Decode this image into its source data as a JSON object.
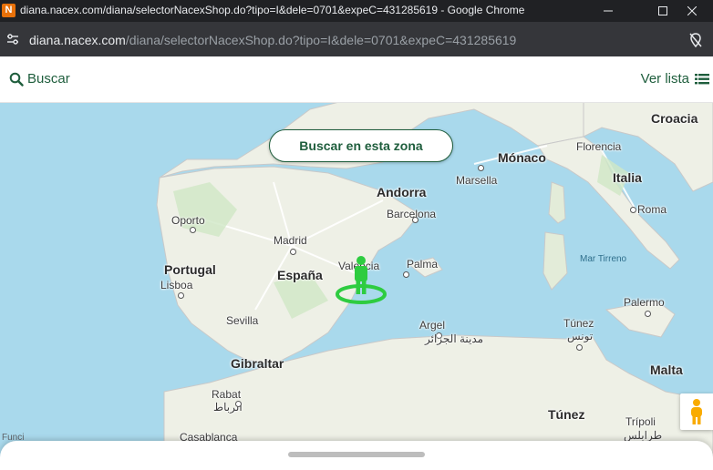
{
  "window": {
    "favicon_letter": "N",
    "title": "diana.nacex.com/diana/selectorNacexShop.do?tipo=I&dele=0701&expeC=431285619 - Google Chrome"
  },
  "address": {
    "host": "diana.nacex.com",
    "path": "/diana/selectorNacexShop.do?tipo=I&dele=0701&expeC=431285619"
  },
  "toolbar": {
    "search_label": "Buscar",
    "list_label": "Ver lista"
  },
  "map": {
    "zone_button_label": "Buscar en esta zona",
    "countries": [
      "España",
      "Portugal",
      "Andorra",
      "Mónaco",
      "Italia",
      "Croacia",
      "Malta",
      "Túnez",
      "Gibraltar"
    ],
    "cities": [
      "Oporto",
      "Madrid",
      "Barcelona",
      "Valencia",
      "Palma",
      "Lisboa",
      "Sevilla",
      "Marsella",
      "Florencia",
      "Roma",
      "Palermo",
      "Argel",
      "Rabat",
      "Casablanca",
      "Trípoli"
    ],
    "arabic_labels": {
      "argel": "مدينة الجزائر",
      "rabat": "الرباط",
      "tunez": "تونس",
      "tripoli": "طرابلس"
    },
    "sea": "Mar Tirreno",
    "attribution_partial": "Funci"
  },
  "colors": {
    "brand_green": "#1f5e3d",
    "marker_green": "#2ecc40",
    "sea": "#a9d9ec",
    "land": "#eef0e6"
  }
}
